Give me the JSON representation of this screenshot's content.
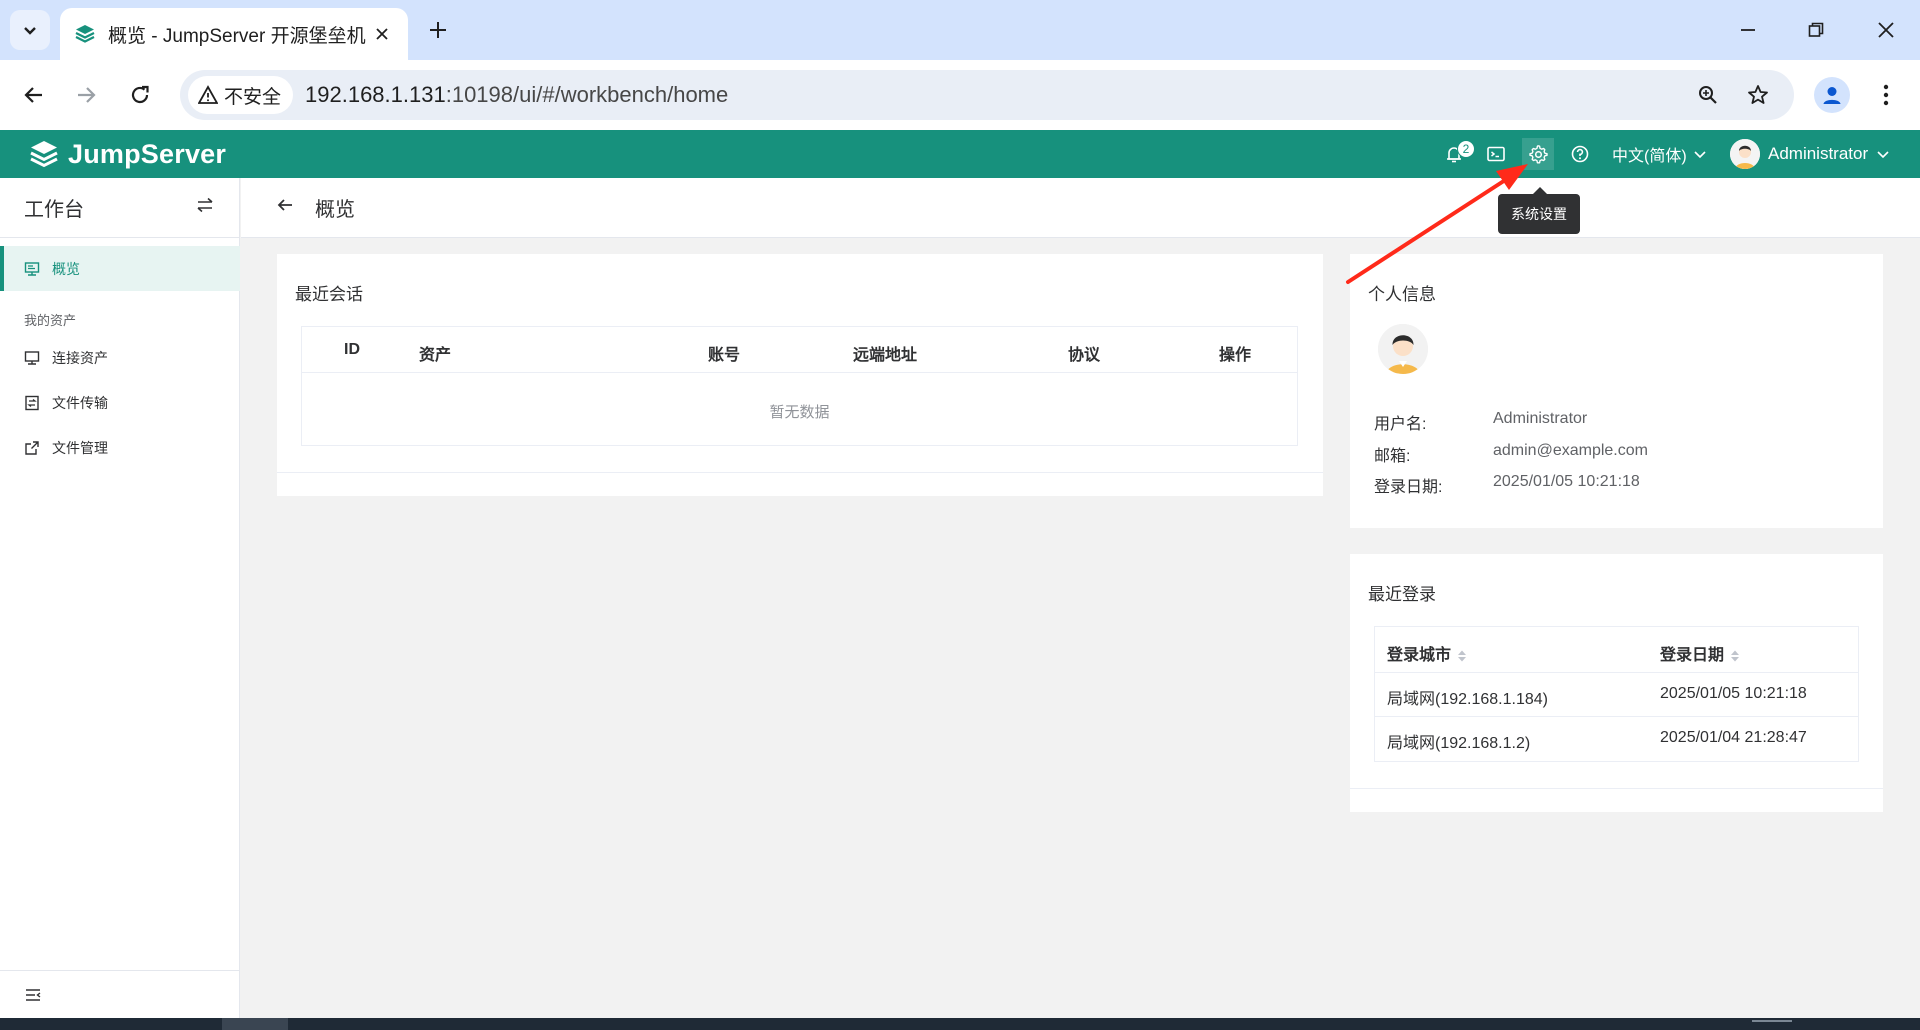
{
  "browser": {
    "tab_title": "概览 - JumpServer 开源堡垒机",
    "security_chip": "不安全",
    "url_host": "192.168.1.131",
    "url_rest": ":10198/ui/#/workbench/home"
  },
  "header": {
    "logo_text": "JumpServer",
    "notification_count": "2",
    "language": "中文(简体)",
    "username": "Administrator",
    "tooltip": "系统设置"
  },
  "sidebar": {
    "title": "工作台",
    "items": [
      {
        "label": "概览"
      },
      {
        "label": "连接资产"
      },
      {
        "label": "文件传输"
      },
      {
        "label": "文件管理"
      }
    ],
    "group_label": "我的资产"
  },
  "page": {
    "title": "概览"
  },
  "recent_sessions": {
    "title": "最近会话",
    "columns": [
      "ID",
      "资产",
      "账号",
      "远端地址",
      "协议",
      "操作"
    ],
    "empty_text": "暂无数据"
  },
  "profile": {
    "title": "个人信息",
    "fields": [
      {
        "label": "用户名:",
        "value": "Administrator"
      },
      {
        "label": "邮箱:",
        "value": "admin@example.com"
      },
      {
        "label": "登录日期:",
        "value": "2025/01/05 10:21:18"
      }
    ]
  },
  "recent_logins": {
    "title": "最近登录",
    "columns": [
      "登录城市",
      "登录日期"
    ],
    "rows": [
      [
        "局域网(192.168.1.184)",
        "2025/01/05 10:21:18"
      ],
      [
        "局域网(192.168.1.2)",
        "2025/01/04 21:28:47"
      ]
    ]
  },
  "colors": {
    "brand": "#17917d",
    "tabstrip": "#d3e3fd",
    "annotation_arrow": "#ff2a1a"
  },
  "icons": {
    "header": [
      "bell-icon",
      "terminal-icon",
      "gear-icon",
      "help-icon"
    ],
    "sidebar": [
      "swap-icon",
      "monitor-icon",
      "file-transfer-icon",
      "external-link-icon",
      "collapse-menu-icon"
    ]
  }
}
